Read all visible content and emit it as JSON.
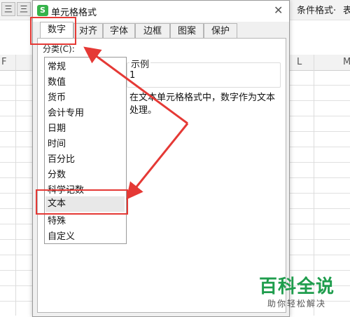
{
  "toolbar": {
    "left_icons": [
      "三",
      "三"
    ],
    "conditional_format": "条件格式·",
    "truncated": "表"
  },
  "sheet": {
    "columns": {
      "f": "F",
      "l": "L",
      "m": "M"
    }
  },
  "dialog": {
    "title": "单元格格式",
    "close_glyph": "✕",
    "app_icon_text": "S",
    "tabs": [
      {
        "label": "数字"
      },
      {
        "label": "对齐"
      },
      {
        "label": "字体"
      },
      {
        "label": "边框"
      },
      {
        "label": "图案"
      },
      {
        "label": "保护"
      }
    ],
    "category_label": "分类(C):",
    "categories": [
      {
        "label": "常规"
      },
      {
        "label": "数值"
      },
      {
        "label": "货币"
      },
      {
        "label": "会计专用"
      },
      {
        "label": "日期"
      },
      {
        "label": "时间"
      },
      {
        "label": "百分比"
      },
      {
        "label": "分数"
      },
      {
        "label": "科学记数"
      },
      {
        "label": "文本"
      },
      {
        "label": "特殊"
      },
      {
        "label": "自定义"
      }
    ],
    "selected_category": "文本",
    "sample_label": "示例",
    "sample_value": "1",
    "description": "在文本单元格格式中，数字作为文本处理。"
  },
  "watermark": {
    "title": "百科全说",
    "subtitle": "助你轻松解决"
  },
  "colors": {
    "annotation": "#e53935",
    "watermark": "#1f9d4d",
    "logo": "#36b34a"
  }
}
